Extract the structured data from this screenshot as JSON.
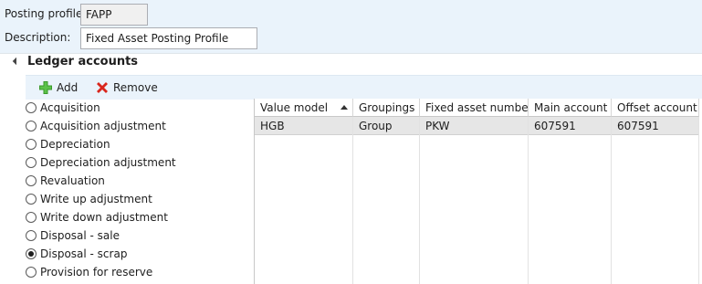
{
  "header": {
    "posting_profile_label": "Posting profile:",
    "posting_profile_value": "FAPP",
    "description_label": "Description:",
    "description_value": "Fixed Asset Posting Profile"
  },
  "ledger_section": {
    "title": "Ledger accounts",
    "toolbar": {
      "add_label": "Add",
      "remove_label": "Remove"
    },
    "transaction_types": [
      {
        "label": "Acquisition",
        "selected": false
      },
      {
        "label": "Acquisition adjustment",
        "selected": false
      },
      {
        "label": "Depreciation",
        "selected": false
      },
      {
        "label": "Depreciation adjustment",
        "selected": false
      },
      {
        "label": "Revaluation",
        "selected": false
      },
      {
        "label": "Write up adjustment",
        "selected": false
      },
      {
        "label": "Write down adjustment",
        "selected": false
      },
      {
        "label": "Disposal - sale",
        "selected": false
      },
      {
        "label": "Disposal - scrap",
        "selected": true
      },
      {
        "label": "Provision for reserve",
        "selected": false
      }
    ],
    "grid": {
      "columns": [
        "Value model",
        "Groupings",
        "Fixed asset number",
        "Main account",
        "Offset account"
      ],
      "rows": [
        [
          "HGB",
          "Group",
          "PKW",
          "607591",
          "607591"
        ]
      ]
    }
  },
  "colors": {
    "header_bg": "#eaf3fb",
    "selected_row": "#e6e6e6",
    "add_icon": "#3a9a2a",
    "remove_icon": "#d9261c"
  }
}
